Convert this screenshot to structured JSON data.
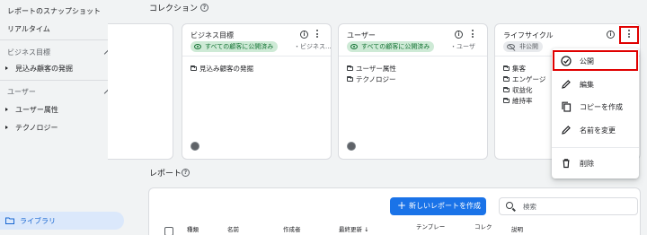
{
  "sidebar": {
    "items_top": [
      {
        "label": "レポートのスナップショット"
      },
      {
        "label": "リアルタイム"
      }
    ],
    "sections": [
      {
        "title": "ビジネス目標",
        "items": [
          {
            "label": "見込み顧客の発掘"
          }
        ]
      },
      {
        "title": "ユーザー",
        "items": [
          {
            "label": "ユーザー属性"
          },
          {
            "label": "テクノロジー"
          }
        ]
      }
    ],
    "library_label": "ライブラリ"
  },
  "main": {
    "collection_title": "コレクション",
    "cards": [
      {
        "name": "ビジネス目標",
        "status": "すべての顧客に公開済み",
        "extra": "・ビジネス...",
        "reports": [
          "見込み顧客の発掘"
        ]
      },
      {
        "name": "ユーザー",
        "status": "すべての顧客に公開済み",
        "extra": "・ユーザ",
        "reports": [
          "ユーザー属性",
          "テクノロジー"
        ]
      },
      {
        "name": "ライフサイクル",
        "status": "非公開",
        "reports": [
          "集客",
          "エンゲージ",
          "収益化",
          "維持率"
        ]
      }
    ],
    "reports_title": "レポート",
    "new_report_label": "新しいレポートを作成",
    "search_placeholder": "検索",
    "table_headers": [
      "種類",
      "名前",
      "作成者",
      "最終更新 ↓",
      "テンプレー",
      "コレク",
      "説明"
    ]
  },
  "context_menu": {
    "items": [
      {
        "label": "公開",
        "icon": "check-circle-icon"
      },
      {
        "label": "編集",
        "icon": "pencil-icon"
      },
      {
        "label": "コピーを作成",
        "icon": "copy-icon"
      },
      {
        "label": "名前を変更",
        "icon": "pencil-icon"
      },
      {
        "label": "削除",
        "icon": "trash-icon"
      }
    ]
  },
  "colors": {
    "accent": "#1a73e8",
    "published_chip_bg": "#ceead6",
    "published_chip_text": "#137333",
    "highlight": "#e00000"
  }
}
